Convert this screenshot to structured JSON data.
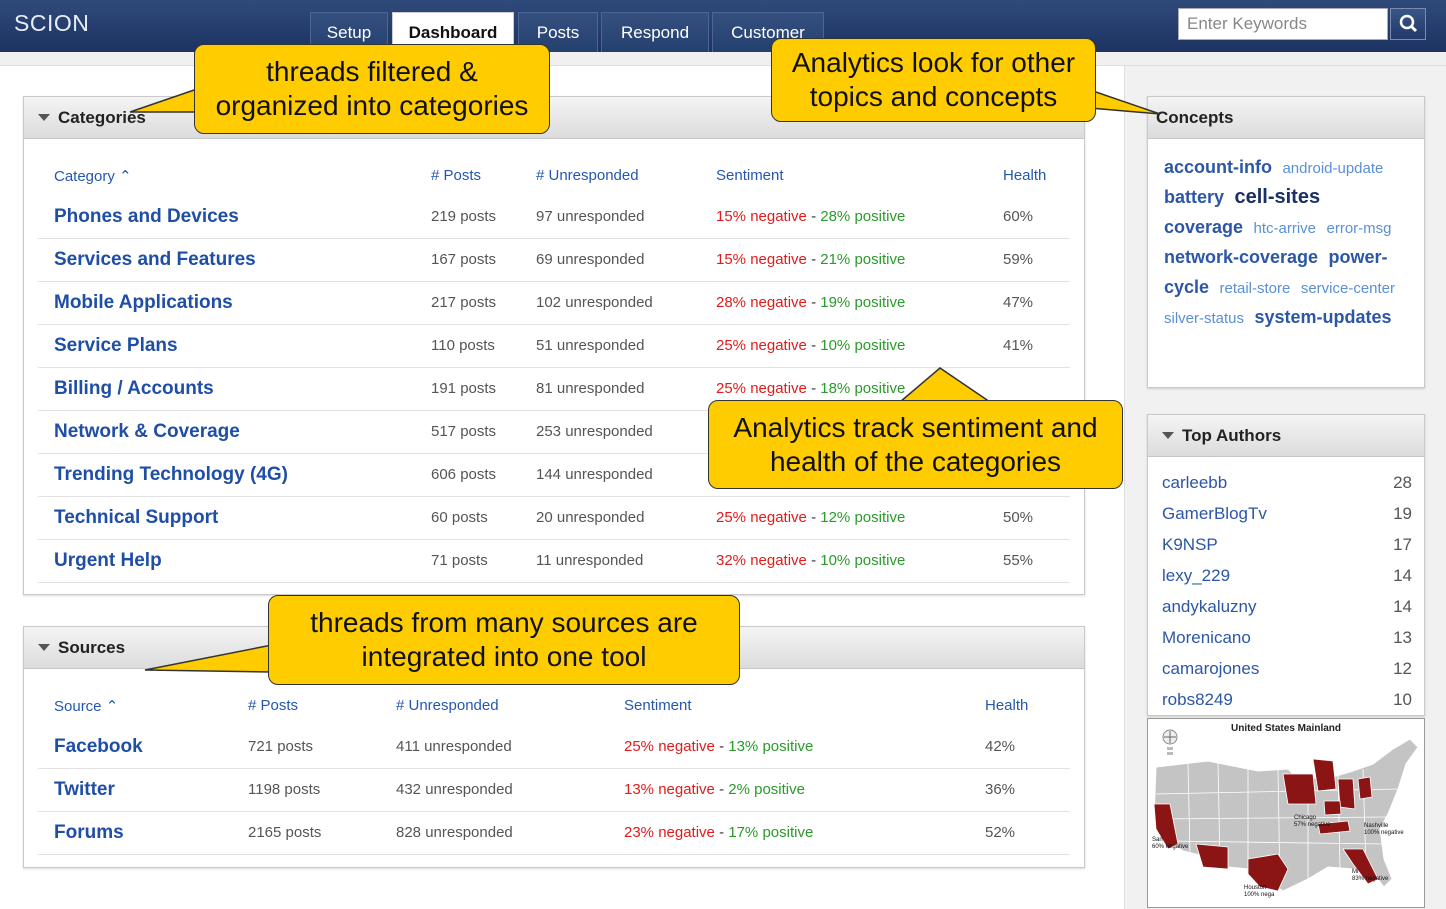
{
  "app": {
    "title": "SCION"
  },
  "nav": {
    "tabs": [
      "Setup",
      "Dashboard",
      "Posts",
      "Respond",
      "Customer"
    ],
    "active_tab": "Dashboard"
  },
  "search": {
    "placeholder": "Enter Keywords"
  },
  "categories": {
    "title": "Categories",
    "columns": {
      "name": "Category",
      "posts": "# Posts",
      "unresponded": "# Unresponded",
      "sentiment": "Sentiment",
      "health": "Health"
    },
    "rows": [
      {
        "name": "Phones and Devices",
        "posts": "219 posts",
        "unresponded": "97 unresponded",
        "negative": "15% negative",
        "separator": " - ",
        "positive": "28% positive",
        "health": "60%"
      },
      {
        "name": "Services and Features",
        "posts": "167 posts",
        "unresponded": "69 unresponded",
        "negative": "15% negative",
        "separator": " - ",
        "positive": "21% positive",
        "health": "59%"
      },
      {
        "name": "Mobile Applications",
        "posts": "217 posts",
        "unresponded": "102 unresponded",
        "negative": "28% negative",
        "separator": " - ",
        "positive": "19% positive",
        "health": "47%"
      },
      {
        "name": "Service Plans",
        "posts": "110 posts",
        "unresponded": "51 unresponded",
        "negative": "25% negative",
        "separator": " - ",
        "positive": "10% positive",
        "health": "41%"
      },
      {
        "name": "Billing / Accounts",
        "posts": "191 posts",
        "unresponded": "81 unresponded",
        "negative": "25% negative",
        "separator": " - ",
        "positive": "18% positive",
        "health": ""
      },
      {
        "name": "Network & Coverage",
        "posts": "517 posts",
        "unresponded": "253 unresponded",
        "negative": "",
        "separator": "",
        "positive": "",
        "health": ""
      },
      {
        "name": "Trending Technology (4G)",
        "posts": "606 posts",
        "unresponded": "144 unresponded",
        "negative": "",
        "separator": "",
        "positive": "",
        "health": ""
      },
      {
        "name": "Technical Support",
        "posts": "60 posts",
        "unresponded": "20 unresponded",
        "negative": "25% negative",
        "separator": " - ",
        "positive": "12% positive",
        "health": "50%"
      },
      {
        "name": "Urgent Help",
        "posts": "71 posts",
        "unresponded": "11 unresponded",
        "negative": "32% negative",
        "separator": " - ",
        "positive": "10% positive",
        "health": "55%"
      }
    ]
  },
  "sources": {
    "title": "Sources",
    "columns": {
      "name": "Source",
      "posts": "# Posts",
      "unresponded": "# Unresponded",
      "sentiment": "Sentiment",
      "health": "Health"
    },
    "rows": [
      {
        "name": "Facebook",
        "posts": "721 posts",
        "unresponded": "411 unresponded",
        "negative": "25% negative",
        "separator": " - ",
        "positive": "13% positive",
        "health": "42%"
      },
      {
        "name": "Twitter",
        "posts": "1198 posts",
        "unresponded": "432 unresponded",
        "negative": "13% negative",
        "separator": " - ",
        "positive": "2% positive",
        "health": "36%"
      },
      {
        "name": "Forums",
        "posts": "2165 posts",
        "unresponded": "828 unresponded",
        "negative": "23% negative",
        "separator": " - ",
        "positive": "17% positive",
        "health": "52%"
      }
    ]
  },
  "concepts": {
    "title": "Concepts",
    "tags": [
      {
        "text": "account-info",
        "weight": 2
      },
      {
        "text": "android-update",
        "weight": 1
      },
      {
        "text": "battery",
        "weight": 2
      },
      {
        "text": "cell-sites",
        "weight": 3
      },
      {
        "text": "coverage",
        "weight": 2
      },
      {
        "text": "htc-arrive",
        "weight": 1
      },
      {
        "text": "error-msg",
        "weight": 1
      },
      {
        "text": "network-coverage",
        "weight": 2
      },
      {
        "text": "power-cycle",
        "weight": 2
      },
      {
        "text": "retail-store",
        "weight": 1
      },
      {
        "text": "service-center",
        "weight": 1
      },
      {
        "text": "silver-status",
        "weight": 1
      },
      {
        "text": "system-updates",
        "weight": 2
      }
    ]
  },
  "top_authors": {
    "title": "Top Authors",
    "rows": [
      {
        "name": "carleebb",
        "count": "28"
      },
      {
        "name": "GamerBlogTv",
        "count": "19"
      },
      {
        "name": "K9NSP",
        "count": "17"
      },
      {
        "name": "lexy_229",
        "count": "14"
      },
      {
        "name": "andykaluzny",
        "count": "14"
      },
      {
        "name": "Morenicano",
        "count": "13"
      },
      {
        "name": "camarojones",
        "count": "12"
      },
      {
        "name": "robs8249",
        "count": "10"
      }
    ]
  },
  "map": {
    "title": "United States Mainland",
    "labels": [
      {
        "text": "Chicago\n57% negative"
      },
      {
        "text": "Nashville\n100% negative"
      },
      {
        "text": "San\n60% negative"
      },
      {
        "text": "Houston\n100% nega"
      },
      {
        "text": "Mi\n83% negative"
      }
    ],
    "colors": {
      "land": "#c8c8c8",
      "highlight": "#8b1414"
    }
  },
  "callouts": {
    "categories": "threads filtered &\norganized into categories",
    "concepts": "Analytics look for other\ntopics and concepts",
    "sentiment": "Analytics track sentiment and\nhealth of the categories",
    "sources": "threads from many sources are\nintegrated into one tool"
  },
  "colors": {
    "negative": "#e01b1b",
    "positive": "#2a9a2a",
    "link": "#1f4ea6",
    "callout": "#ffcc00"
  }
}
